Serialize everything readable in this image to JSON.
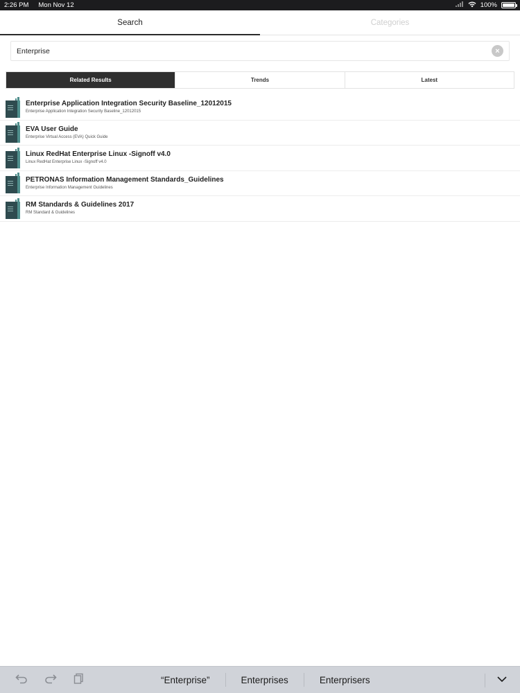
{
  "status_bar": {
    "time": "2:26 PM",
    "date": "Mon Nov 12",
    "battery": "100%",
    "battery_level": 1.0
  },
  "top_tabs": [
    {
      "label": "Search",
      "active": true
    },
    {
      "label": "Categories",
      "active": false
    }
  ],
  "search": {
    "value": "Enterprise",
    "clear_icon": "clear-icon"
  },
  "segments": [
    {
      "label": "Related Results",
      "active": true
    },
    {
      "label": "Trends",
      "active": false
    },
    {
      "label": "Latest",
      "active": false
    }
  ],
  "results": [
    {
      "title": "Enterprise Application Integration Security Baseline_12012015",
      "subtitle": "Enterprise Application Integration Security Baseline_12012015"
    },
    {
      "title": "EVA User Guide",
      "subtitle": "Enterprise Virtual Access (EVA) Quick Guide"
    },
    {
      "title": "Linux RedHat Enterprise Linux -Signoff v4.0",
      "subtitle": "Linux RedHat Enterprise Linux -Signoff v4.0"
    },
    {
      "title": "PETRONAS Information Management Standards_Guidelines",
      "subtitle": "Enterprise Information Management Guidelines"
    },
    {
      "title": "RM Standards & Guidelines 2017",
      "subtitle": "RM Standard & Guidelines"
    }
  ],
  "keyboard": {
    "suggestions": [
      "“Enterprise”",
      "Enterprises",
      "Enterprisers"
    ],
    "tools": [
      "undo-icon",
      "redo-icon",
      "paste-icon"
    ],
    "dismiss_icon": "chevron-down-icon"
  },
  "colors": {
    "accent_dark": "#2f2f2f",
    "doc_cover": "#2f4b4f",
    "doc_spine": "#4f8e8c"
  }
}
